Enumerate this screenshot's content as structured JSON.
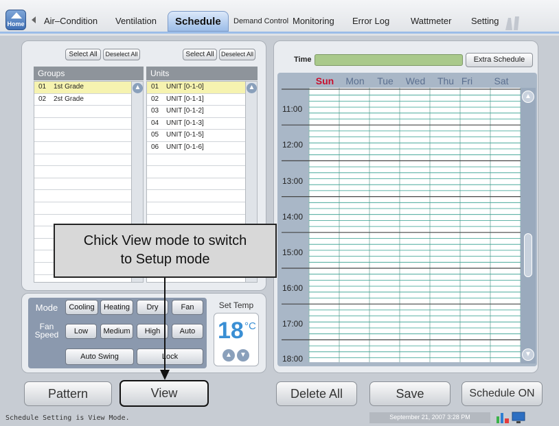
{
  "tabs": {
    "home": "Home",
    "items": [
      "Air–Condition",
      "Ventilation",
      "Schedule",
      "Demand Control",
      "Monitoring",
      "Error Log",
      "Wattmeter",
      "Setting"
    ]
  },
  "groups": {
    "select_all": "Select All",
    "deselect_all": "Deselect All",
    "header": "Groups",
    "rows": [
      {
        "num": "01",
        "name": "1st Grade"
      },
      {
        "num": "02",
        "name": "2st Grade"
      }
    ]
  },
  "units": {
    "select_all": "Select All",
    "deselect_all": "Deselect All",
    "header": "Units",
    "rows": [
      {
        "num": "01",
        "name": "UNIT [0-1-0]"
      },
      {
        "num": "02",
        "name": "UNIT [0-1-1]"
      },
      {
        "num": "03",
        "name": "UNIT [0-1-2]"
      },
      {
        "num": "04",
        "name": "UNIT [0-1-3]"
      },
      {
        "num": "05",
        "name": "UNIT [0-1-5]"
      },
      {
        "num": "06",
        "name": "UNIT [0-1-6]"
      }
    ]
  },
  "control": {
    "mode_label": "Mode",
    "modes": [
      "Cooling",
      "Heating",
      "Dry",
      "Fan"
    ],
    "fan_label_1": "Fan",
    "fan_label_2": "Speed",
    "fan_speeds": [
      "Low",
      "Medium",
      "High",
      "Auto"
    ],
    "auto_swing": "Auto Swing",
    "lock": "Lock",
    "set_temp_label": "Set Temp",
    "set_temp_value": "18",
    "set_temp_unit": "°C"
  },
  "bottom_left": {
    "pattern": "Pattern",
    "view": "View"
  },
  "schedule": {
    "time_label": "Time",
    "extra_schedule": "Extra Schedule",
    "days": [
      "Sun",
      "Mon",
      "Tue",
      "Wed",
      "Thu",
      "Fri",
      "Sat"
    ],
    "times": [
      "11:00",
      "12:00",
      "13:00",
      "14:00",
      "15:00",
      "16:00",
      "17:00",
      "18:00"
    ]
  },
  "bottom_right": {
    "delete_all": "Delete All",
    "save": "Save",
    "schedule_on": "Schedule ON"
  },
  "callout": {
    "line1": "Chick View mode to switch",
    "line2": "to Setup mode"
  },
  "status_bar": {
    "message": "Schedule Setting is View Mode.",
    "datetime": "September 21, 2007 3:28 PM"
  },
  "colors": {
    "accent": "#9cbde8",
    "sunday": "#c8102e",
    "grid_line": "#2e9c8c",
    "time_bar": "#a9c98b"
  }
}
